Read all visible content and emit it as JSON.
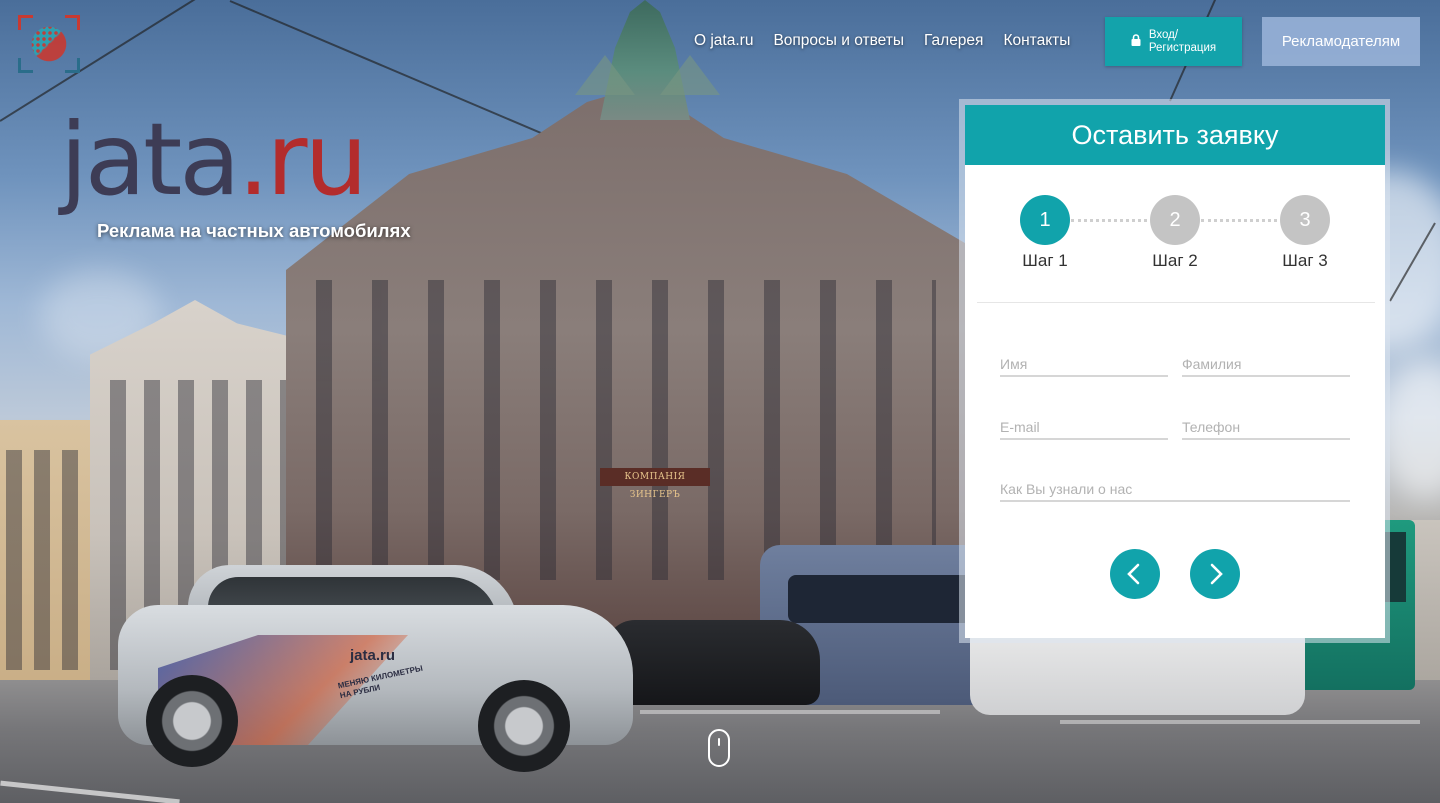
{
  "header": {
    "nav": [
      {
        "label": "О jata.ru"
      },
      {
        "label": "Вопросы и ответы"
      },
      {
        "label": "Галерея"
      },
      {
        "label": "Контакты"
      }
    ],
    "login_label": "Вход/\nРегистрация",
    "login_icon": "lock-icon",
    "advertisers_label": "Рекламодателям"
  },
  "brand": {
    "name_main": "jata",
    "name_tld": ".ru",
    "tagline": "Реклама на частных автомобилях",
    "colors": {
      "main": "#3d3c55",
      "tld": "#b32c2c"
    }
  },
  "scene": {
    "sign_text": "КОМПАНІЯ ЗИНГЕРЪ",
    "car_brand": "jata.ru",
    "car_slogan": "МЕНЯЮ КИЛОМЕТРЫ НА РУБЛИ"
  },
  "form": {
    "title": "Оставить заявку",
    "steps": [
      {
        "number": "1",
        "label": "Шаг 1",
        "active": true
      },
      {
        "number": "2",
        "label": "Шаг 2",
        "active": false
      },
      {
        "number": "3",
        "label": "Шаг 3",
        "active": false
      }
    ],
    "fields": {
      "first_name": {
        "placeholder": "Имя",
        "value": ""
      },
      "last_name": {
        "placeholder": "Фамилия",
        "value": ""
      },
      "email": {
        "placeholder": "E-mail",
        "value": ""
      },
      "phone": {
        "placeholder": "Телефон",
        "value": ""
      },
      "source": {
        "placeholder": "Как Вы узнали о нас",
        "value": ""
      }
    },
    "prev_icon": "chevron-left-icon",
    "next_icon": "chevron-right-icon",
    "accent": "#11a3ab"
  },
  "scroll_hint_icon": "mouse-icon"
}
